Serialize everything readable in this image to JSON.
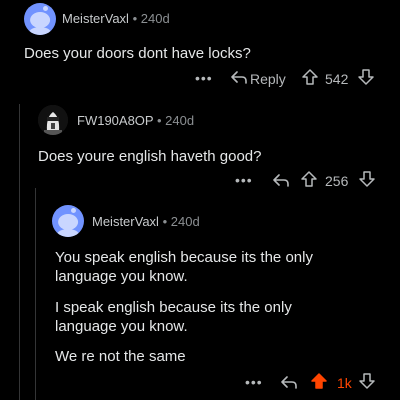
{
  "comments": [
    {
      "username": "MeisterVaxl",
      "age": "240d",
      "body": "Does your doors dont have locks?",
      "reply_label": "Reply",
      "score": "542",
      "upvoted": false
    },
    {
      "username": "FW190A8OP",
      "age": "240d",
      "body": "Does youre english haveth good?",
      "score": "256",
      "upvoted": false
    },
    {
      "username": "MeisterVaxl",
      "age": "240d",
      "paragraphs": [
        "You speak english because its the only language you know.",
        "I speak english because its the only language you know.",
        "We re not the same"
      ],
      "score": "1k",
      "upvoted": true
    }
  ],
  "separator": "•",
  "more_glyph": "•••",
  "colors": {
    "background": "#000000",
    "text": "#d7dadc",
    "muted": "#8b8f92",
    "upvote_active": "#ff4500",
    "snoo_avatar": "#7193ff"
  }
}
